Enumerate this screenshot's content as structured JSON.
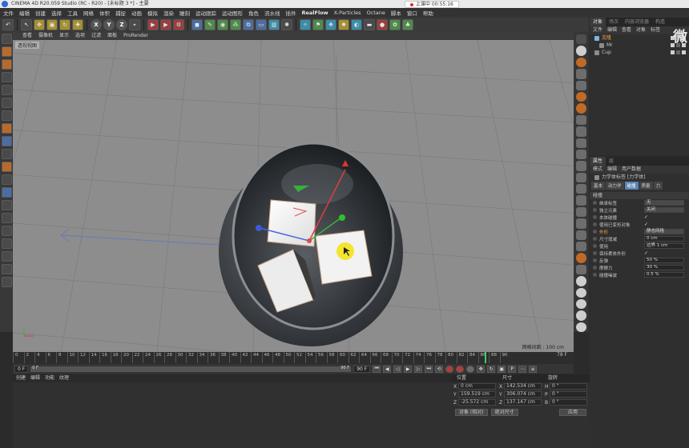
{
  "window": {
    "title": "CINEMA 4D R20.059 Studio (RC - R20) - [未标题 3 *] - 主要"
  },
  "recording": {
    "label": "上课中 00:55:16"
  },
  "menubar": [
    "文件",
    "编辑",
    "创建",
    "选择",
    "工具",
    "网格",
    "体积",
    "捕捉",
    "动画",
    "模拟",
    "渲染",
    "雕刻",
    "运动跟踪",
    "运动图形",
    "角色",
    "流水线",
    "插件",
    "RealFlow",
    "X-Particles",
    "Octane",
    "脚本",
    "窗口",
    "帮助"
  ],
  "toolbar": {
    "axis_x": "X",
    "axis_y": "Y",
    "axis_z": "Z"
  },
  "viewport": {
    "menu": [
      "查看",
      "摄像机",
      "显示",
      "选项",
      "过滤",
      "面板",
      "ProRender"
    ],
    "label": "透视视图",
    "grid_distance": "网格间距 : 100 cm"
  },
  "object_manager": {
    "tabs": [
      "对象",
      "场次",
      "内容浏览器",
      "构造"
    ],
    "menu": [
      "文件",
      "编辑",
      "查看",
      "对象",
      "标签"
    ],
    "objects": [
      {
        "name": "克隆",
        "selected": true
      },
      {
        "name": "Mr",
        "selected": false
      },
      {
        "name": "Cup",
        "selected": false
      }
    ],
    "watermark": "微"
  },
  "attributes": {
    "tabs": [
      "属性",
      "层"
    ],
    "menu": [
      "模式",
      "编辑",
      "用户数据"
    ],
    "tag_title": "力学体标签 [力学体]",
    "subtabs": [
      "基本",
      "动力学",
      "碰撞",
      "质量",
      "力"
    ],
    "active_subtab": "碰撞",
    "section": "碰撞",
    "rows": [
      {
        "label": "继承标签",
        "value": "无",
        "highlight": false
      },
      {
        "label": "独立元素",
        "value": "关闭",
        "highlight": false
      },
      {
        "label": "本体碰撞",
        "check": "✓",
        "highlight": false
      },
      {
        "label": "使用已变形对象",
        "check": "✓",
        "highlight": false
      },
      {
        "label": "外形",
        "value": "静态网格",
        "highlight": true
      },
      {
        "label": "尺寸增减",
        "value": "0 cm",
        "highlight": false
      },
      {
        "label": "使用",
        "value": "边界 1 cm",
        "highlight": false
      },
      {
        "label": "保持柔体外形",
        "check": "✓",
        "highlight": false
      },
      {
        "label": "反弹",
        "value": "50 %",
        "highlight": false
      },
      {
        "label": "摩擦力",
        "value": "30 %",
        "highlight": false
      },
      {
        "label": "碰撞噪波",
        "value": "0.5 %",
        "highlight": false
      }
    ]
  },
  "timeline": {
    "ticks": [
      "0",
      "2",
      "4",
      "6",
      "8",
      "10",
      "12",
      "14",
      "16",
      "18",
      "20",
      "22",
      "24",
      "26",
      "28",
      "30",
      "32",
      "34",
      "36",
      "38",
      "40",
      "42",
      "44",
      "46",
      "48",
      "50",
      "52",
      "54",
      "56",
      "58",
      "60",
      "62",
      "64",
      "66",
      "68",
      "70",
      "72",
      "74",
      "76",
      "78",
      "80",
      "82",
      "84",
      "86",
      "88",
      "90"
    ],
    "current_frame": 79,
    "end_label": "78 F"
  },
  "transport": {
    "start_field": "0 F",
    "range_start": "0 F",
    "range_end": "90 F",
    "end_field": "90 F"
  },
  "material_panel": {
    "menu": [
      "创建",
      "编辑",
      "功能",
      "纹理"
    ]
  },
  "coordinates": {
    "headers": [
      "位置",
      "尺寸",
      "旋转"
    ],
    "rows": [
      {
        "axis": [
          "X",
          "X",
          "H"
        ],
        "values": [
          "0 cm",
          "142.534 cm",
          "0 °"
        ]
      },
      {
        "axis": [
          "Y",
          "Y",
          "P"
        ],
        "values": [
          "159.519 cm",
          "306.074 cm",
          "0 °"
        ]
      },
      {
        "axis": [
          "Z",
          "Z",
          "B"
        ],
        "values": [
          "-25.572 cm",
          "137.147 cm",
          "0 °"
        ]
      }
    ],
    "mode_object": "对象 (相对)",
    "mode_size": "绝对尺寸",
    "apply": "应用"
  }
}
